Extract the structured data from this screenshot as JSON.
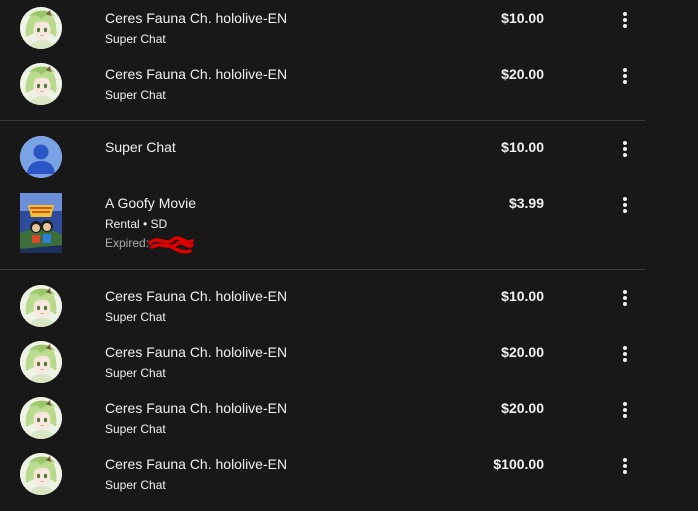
{
  "purchases": {
    "group1": [
      {
        "title": "Ceres Fauna Ch. hololive-EN",
        "subtitle": "Super Chat",
        "amount": "$10.00",
        "avatar": "vtuber-avatar"
      },
      {
        "title": "Ceres Fauna Ch. hololive-EN",
        "subtitle": "Super Chat",
        "amount": "$20.00",
        "avatar": "vtuber-avatar"
      }
    ],
    "group2": [
      {
        "title": "Super Chat",
        "amount": "$10.00",
        "avatar": "default-user-avatar"
      },
      {
        "title": "A Goofy Movie",
        "subtitle": "Rental • SD",
        "expired_label": "Expired:",
        "amount": "$3.99",
        "thumbnail": "movie-poster"
      }
    ],
    "group3": [
      {
        "title": "Ceres Fauna Ch. hololive-EN",
        "subtitle": "Super Chat",
        "amount": "$10.00",
        "avatar": "vtuber-avatar"
      },
      {
        "title": "Ceres Fauna Ch. hololive-EN",
        "subtitle": "Super Chat",
        "amount": "$20.00",
        "avatar": "vtuber-avatar"
      },
      {
        "title": "Ceres Fauna Ch. hololive-EN",
        "subtitle": "Super Chat",
        "amount": "$20.00",
        "avatar": "vtuber-avatar"
      },
      {
        "title": "Ceres Fauna Ch. hololive-EN",
        "subtitle": "Super Chat",
        "amount": "$100.00",
        "avatar": "vtuber-avatar"
      }
    ]
  },
  "icons": {
    "menu": "more-vertical-icon"
  },
  "colors": {
    "background": "#181818",
    "divider": "#3a3a3a",
    "redaction": "#e00000",
    "default_avatar": "#7aa3e5"
  }
}
